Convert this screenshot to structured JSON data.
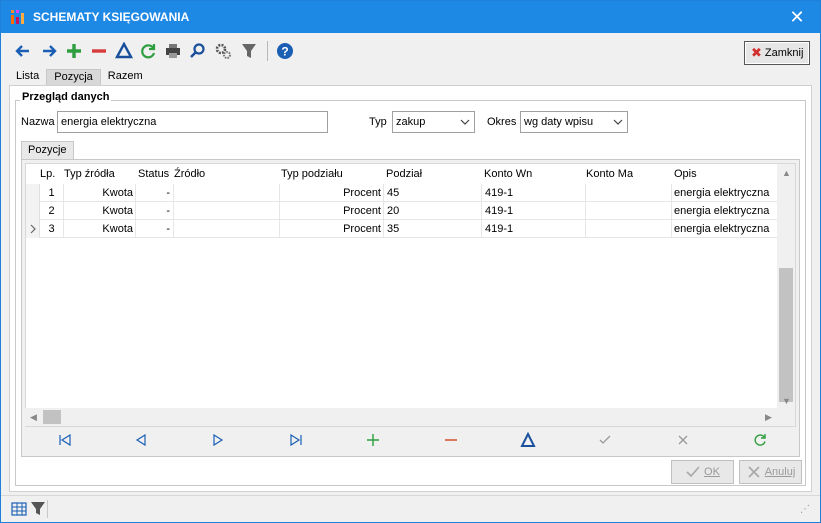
{
  "window": {
    "title": "SCHEMATY KSIĘGOWANIA"
  },
  "toolbar": {
    "close_label": "Zamknij"
  },
  "tabs": [
    {
      "label": "Lista"
    },
    {
      "label": "Pozycja"
    },
    {
      "label": "Razem"
    }
  ],
  "group": {
    "title": "Przegląd danych"
  },
  "form": {
    "nazwa_label": "Nazwa",
    "nazwa_value": "energia elektryczna",
    "typ_label": "Typ",
    "typ_value": "zakup",
    "okres_label": "Okres",
    "okres_value": "wg daty wpisu"
  },
  "subtab": {
    "label": "Pozycje"
  },
  "grid": {
    "columns": [
      "Lp.",
      "Typ źródła",
      "Status",
      "Źródło",
      "Typ podziału",
      "Podział",
      "Konto Wn",
      "Konto Ma",
      "Opis"
    ],
    "rows": [
      {
        "lp": "1",
        "typ_zrodla": "Kwota",
        "status": "-",
        "zrodlo": "",
        "typ_podzialu": "Procent",
        "podzial": "45",
        "konto_wn": "419-1",
        "konto_ma": "",
        "opis": "energia elektryczna"
      },
      {
        "lp": "2",
        "typ_zrodla": "Kwota",
        "status": "-",
        "zrodlo": "",
        "typ_podzialu": "Procent",
        "podzial": "20",
        "konto_wn": "419-1",
        "konto_ma": "",
        "opis": "energia elektryczna"
      },
      {
        "lp": "3",
        "typ_zrodla": "Kwota",
        "status": "-",
        "zrodlo": "",
        "typ_podzialu": "Procent",
        "podzial": "35",
        "konto_wn": "419-1",
        "konto_ma": "",
        "opis": "energia elektryczna"
      }
    ]
  },
  "buttons": {
    "ok_label": "OK",
    "cancel_label": "Anuluj"
  },
  "colors": {
    "titlebar": "#1e88e5",
    "accent_blue": "#1a5fb4",
    "green": "#2e9e3e",
    "red": "#d83b3b"
  }
}
